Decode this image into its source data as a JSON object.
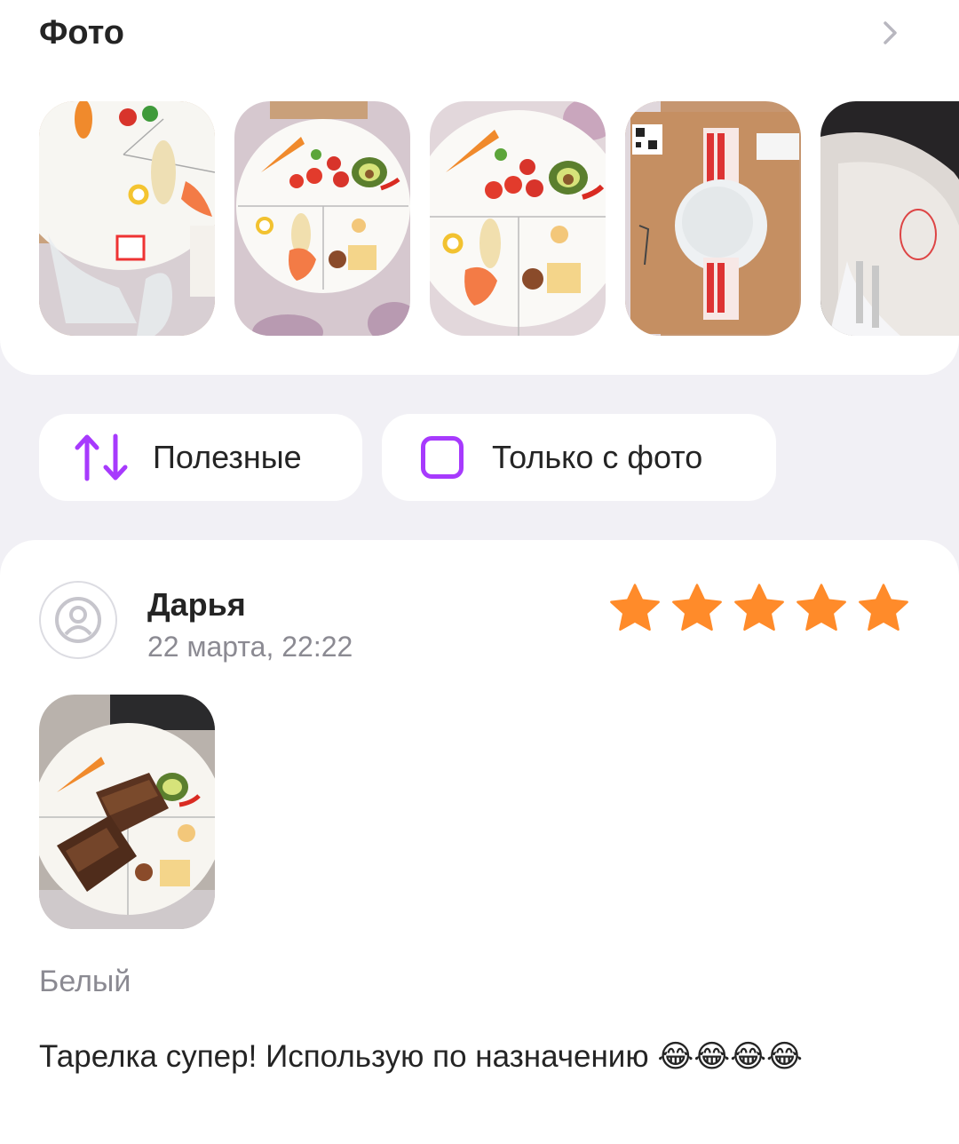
{
  "photos_section": {
    "title": "Фото",
    "chevron_icon": "chevron-right-icon",
    "photos": [
      {
        "name": "photo-plate-with-stand"
      },
      {
        "name": "photo-plate-front"
      },
      {
        "name": "photo-plate-closeup"
      },
      {
        "name": "photo-package-box"
      },
      {
        "name": "photo-plate-edge"
      }
    ]
  },
  "filters": {
    "sort_label": "Полезные",
    "sort_icon": "sort-arrows-icon",
    "photo_only_label": "Только с фото",
    "photo_only_checked": false
  },
  "review": {
    "author": "Дарья",
    "date": "22 марта, 22:22",
    "avatar_icon": "user-avatar-icon",
    "rating": 5,
    "variant": "Белый",
    "text": "Тарелка супер! Использую по назначению 😂😂😂😂"
  },
  "colors": {
    "accent": "#a73afd",
    "star": "#ff8b2a",
    "muted_text": "#8b8a92",
    "background": "#f1f0f5"
  }
}
